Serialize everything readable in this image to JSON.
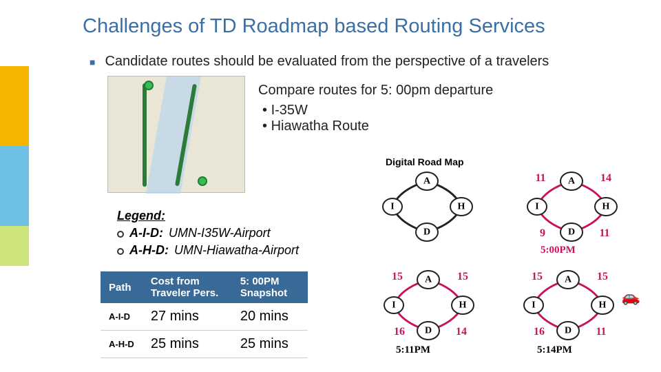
{
  "title": "Challenges of TD Roadmap based Routing Services",
  "bullet": "Candidate routes should be evaluated from the perspective of a travelers",
  "compare": {
    "heading": "Compare routes for 5: 00pm departure",
    "items": [
      "I-35W",
      "Hiawatha Route"
    ]
  },
  "drm_label": "Digital Road Map",
  "legend": {
    "title": "Legend:",
    "rows": [
      {
        "key": "A-I-D:",
        "value": "UMN-I35W-Airport"
      },
      {
        "key": "A-H-D:",
        "value": "UMN-Hiawatha-Airport"
      }
    ]
  },
  "table": {
    "headers": [
      "Path",
      "Cost from Traveler Pers.",
      "5: 00PM Snapshot"
    ],
    "rows": [
      {
        "path": "A-I-D",
        "cost": "27 mins",
        "snap": "20 mins"
      },
      {
        "path": "A-H-D",
        "cost": "25 mins",
        "snap": "25 mins"
      }
    ]
  },
  "graphs": {
    "nodes": [
      "A",
      "I",
      "H",
      "D"
    ],
    "drm": {
      "color": "#222"
    },
    "g2": {
      "color": "#c9125f",
      "caption": "5:00PM",
      "weights": {
        "AI": "11",
        "AH": "14",
        "ID": "9",
        "HD": "11"
      }
    },
    "g3": {
      "color": "#c9125f",
      "caption": "5:11PM",
      "weights": {
        "AI": "15",
        "AH": "15",
        "ID": "16",
        "HD": "14"
      }
    },
    "g4": {
      "color": "#c9125f",
      "caption": "5:14PM",
      "weights": {
        "AI": "15",
        "AH": "15",
        "ID": "16",
        "HD": "11"
      }
    }
  },
  "car_glyph": "🚗"
}
